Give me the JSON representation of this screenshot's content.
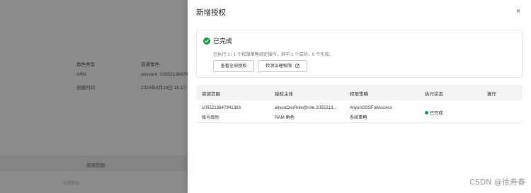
{
  "background": {
    "info_rows": [
      {
        "label": "角色类型",
        "value": "普通角色"
      },
      {
        "label": "ARN",
        "value": "acs:ram::10552138479"
      },
      {
        "label": "创建时间",
        "value": "2024年4月28日 16:10"
      }
    ],
    "tab_label": "资源范围",
    "footer_text": "设置数据"
  },
  "drawer": {
    "title": "新增授权",
    "close_label": "×",
    "result": {
      "title": "已完成",
      "description": "已执行 1 / 1 个权限策略绑定操作，其中 1 个成功，0 个失败。",
      "btn_view_all": "查看全部授权",
      "btn_detect": "检测治理权限"
    },
    "table": {
      "headers": [
        "资源范围",
        "授权主体",
        "权限策略",
        "执行状态",
        "操作"
      ],
      "rows": [
        {
          "scope": "1055213847941393",
          "scope_sub": "账号级别",
          "principal": "aliyunOssRole@role.1055213...",
          "principal_sub": "RAM 角色",
          "policy": "AliyunOSSFullAccess",
          "policy_sub": "系统策略",
          "status": "已完成"
        }
      ]
    }
  },
  "watermark": "CSDN @徐寿春",
  "colors": {
    "success": "#1a9c4a",
    "overlay": "rgba(0,0,0,0.45)"
  }
}
